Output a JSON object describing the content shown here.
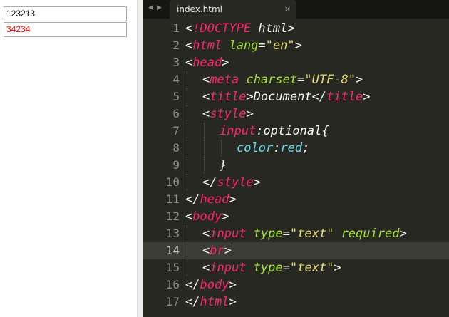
{
  "preview": {
    "input_1_value": "123213",
    "input_2_value": "34234",
    "optional_color": "#ff0000"
  },
  "editor": {
    "tab": {
      "label": "index.html",
      "close": "×"
    },
    "nav": {
      "back": "◀",
      "forward": "▶"
    },
    "active_line": 14,
    "theme": {
      "background": "#272822",
      "tag": "#f92672",
      "attribute": "#a6e22e",
      "string": "#e6db74",
      "property": "#66d9ef",
      "plain": "#f8f8f2"
    },
    "lines": [
      {
        "num": "1",
        "indent": 0,
        "tokens": [
          {
            "t": "<",
            "c": "pl"
          },
          {
            "t": "!DOCTYPE",
            "c": "tag"
          },
          {
            "t": " html>",
            "c": "pl"
          }
        ]
      },
      {
        "num": "2",
        "indent": 0,
        "tokens": [
          {
            "t": "<",
            "c": "pl"
          },
          {
            "t": "html",
            "c": "tag"
          },
          {
            "t": " ",
            "c": "pl"
          },
          {
            "t": "lang",
            "c": "attr"
          },
          {
            "t": "=",
            "c": "pl"
          },
          {
            "t": "\"en\"",
            "c": "str"
          },
          {
            "t": ">",
            "c": "pl"
          }
        ]
      },
      {
        "num": "3",
        "indent": 0,
        "tokens": [
          {
            "t": "<",
            "c": "pl"
          },
          {
            "t": "head",
            "c": "tag"
          },
          {
            "t": ">",
            "c": "pl"
          }
        ]
      },
      {
        "num": "4",
        "indent": 1,
        "tokens": [
          {
            "t": "<",
            "c": "pl"
          },
          {
            "t": "meta",
            "c": "tag"
          },
          {
            "t": " ",
            "c": "pl"
          },
          {
            "t": "charset",
            "c": "attr"
          },
          {
            "t": "=",
            "c": "pl"
          },
          {
            "t": "\"UTF-8\"",
            "c": "str"
          },
          {
            "t": ">",
            "c": "pl"
          }
        ]
      },
      {
        "num": "5",
        "indent": 1,
        "tokens": [
          {
            "t": "<",
            "c": "pl"
          },
          {
            "t": "title",
            "c": "tag"
          },
          {
            "t": ">Document</",
            "c": "pl"
          },
          {
            "t": "title",
            "c": "tag"
          },
          {
            "t": ">",
            "c": "pl"
          }
        ]
      },
      {
        "num": "6",
        "indent": 1,
        "tokens": [
          {
            "t": "<",
            "c": "pl"
          },
          {
            "t": "style",
            "c": "tag"
          },
          {
            "t": ">",
            "c": "pl"
          }
        ]
      },
      {
        "num": "7",
        "indent": 2,
        "tokens": [
          {
            "t": "input",
            "c": "tag"
          },
          {
            "t": ":",
            "c": "pl"
          },
          {
            "t": "optional",
            "c": "pl"
          },
          {
            "t": "{",
            "c": "pl"
          }
        ]
      },
      {
        "num": "8",
        "indent": 3,
        "tokens": [
          {
            "t": "color",
            "c": "prop"
          },
          {
            "t": ":",
            "c": "pl"
          },
          {
            "t": "red",
            "c": "prop"
          },
          {
            "t": ";",
            "c": "pl"
          }
        ]
      },
      {
        "num": "9",
        "indent": 2,
        "tokens": [
          {
            "t": "}",
            "c": "pl"
          }
        ]
      },
      {
        "num": "10",
        "indent": 1,
        "tokens": [
          {
            "t": "</",
            "c": "pl"
          },
          {
            "t": "style",
            "c": "tag"
          },
          {
            "t": ">",
            "c": "pl"
          }
        ]
      },
      {
        "num": "11",
        "indent": 0,
        "tokens": [
          {
            "t": "</",
            "c": "pl"
          },
          {
            "t": "head",
            "c": "tag"
          },
          {
            "t": ">",
            "c": "pl"
          }
        ]
      },
      {
        "num": "12",
        "indent": 0,
        "tokens": [
          {
            "t": "<",
            "c": "pl"
          },
          {
            "t": "body",
            "c": "tag"
          },
          {
            "t": ">",
            "c": "pl"
          }
        ]
      },
      {
        "num": "13",
        "indent": 1,
        "tokens": [
          {
            "t": "<",
            "c": "pl"
          },
          {
            "t": "input",
            "c": "tag"
          },
          {
            "t": " ",
            "c": "pl"
          },
          {
            "t": "type",
            "c": "attr"
          },
          {
            "t": "=",
            "c": "pl"
          },
          {
            "t": "\"text\"",
            "c": "str"
          },
          {
            "t": " ",
            "c": "pl"
          },
          {
            "t": "required",
            "c": "attr"
          },
          {
            "t": ">",
            "c": "pl"
          }
        ]
      },
      {
        "num": "14",
        "indent": 1,
        "tokens": [
          {
            "t": "<",
            "c": "pl"
          },
          {
            "t": "br",
            "c": "tag"
          },
          {
            "t": ">",
            "c": "pl"
          }
        ]
      },
      {
        "num": "15",
        "indent": 1,
        "tokens": [
          {
            "t": "<",
            "c": "pl"
          },
          {
            "t": "input",
            "c": "tag"
          },
          {
            "t": " ",
            "c": "pl"
          },
          {
            "t": "type",
            "c": "attr"
          },
          {
            "t": "=",
            "c": "pl"
          },
          {
            "t": "\"text\"",
            "c": "str"
          },
          {
            "t": ">",
            "c": "pl"
          }
        ]
      },
      {
        "num": "16",
        "indent": 0,
        "tokens": [
          {
            "t": "</",
            "c": "pl"
          },
          {
            "t": "body",
            "c": "tag"
          },
          {
            "t": ">",
            "c": "pl"
          }
        ]
      },
      {
        "num": "17",
        "indent": 0,
        "tokens": [
          {
            "t": "</",
            "c": "pl"
          },
          {
            "t": "html",
            "c": "tag"
          },
          {
            "t": ">",
            "c": "pl"
          }
        ]
      }
    ]
  }
}
